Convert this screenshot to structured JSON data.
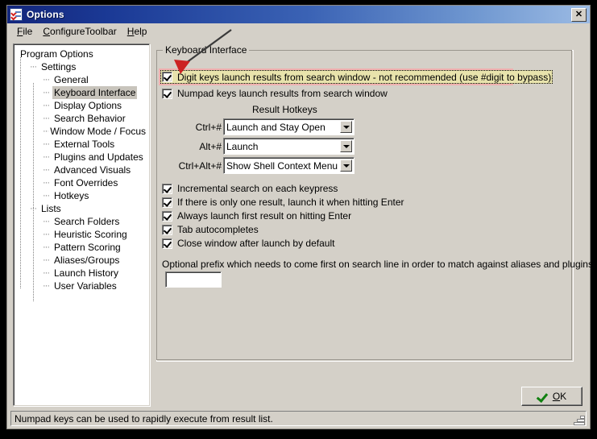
{
  "window": {
    "title": "Options",
    "icon": "options-checklist-icon",
    "close_label": "✕"
  },
  "menubar": {
    "items": [
      {
        "label": "File",
        "accel": "F"
      },
      {
        "label": "ConfigureToolbar",
        "accel": "C"
      },
      {
        "label": "Help",
        "accel": "H"
      }
    ]
  },
  "tree": {
    "nodes": [
      {
        "label": "Program Options",
        "level": 0,
        "selected": false
      },
      {
        "label": "Settings",
        "level": 1,
        "selected": false
      },
      {
        "label": "General",
        "level": 2,
        "selected": false
      },
      {
        "label": "Keyboard Interface",
        "level": 2,
        "selected": true
      },
      {
        "label": "Display Options",
        "level": 2,
        "selected": false
      },
      {
        "label": "Search Behavior",
        "level": 2,
        "selected": false
      },
      {
        "label": "Window Mode / Focus",
        "level": 2,
        "selected": false
      },
      {
        "label": "External Tools",
        "level": 2,
        "selected": false
      },
      {
        "label": "Plugins and Updates",
        "level": 2,
        "selected": false
      },
      {
        "label": "Advanced Visuals",
        "level": 2,
        "selected": false
      },
      {
        "label": "Font Overrides",
        "level": 2,
        "selected": false
      },
      {
        "label": "Hotkeys",
        "level": 2,
        "selected": false
      },
      {
        "label": "Lists",
        "level": 1,
        "selected": false
      },
      {
        "label": "Search Folders",
        "level": 2,
        "selected": false
      },
      {
        "label": "Heuristic Scoring",
        "level": 2,
        "selected": false
      },
      {
        "label": "Pattern Scoring",
        "level": 2,
        "selected": false
      },
      {
        "label": "Aliases/Groups",
        "level": 2,
        "selected": false
      },
      {
        "label": "Launch History",
        "level": 2,
        "selected": false
      },
      {
        "label": "User Variables",
        "level": 2,
        "selected": false
      }
    ]
  },
  "groupbox": {
    "title": "Keyboard Interface",
    "top_checkboxes": [
      {
        "label": "Digit keys launch results from search window  - not recommended (use #digit to bypass)",
        "checked": true,
        "highlighted": true
      },
      {
        "label": "Numpad keys launch results from search window",
        "checked": true,
        "highlighted": false
      }
    ],
    "result_hotkeys": {
      "title": "Result Hotkeys",
      "rows": [
        {
          "label": "Ctrl+#",
          "value": "Launch and Stay Open"
        },
        {
          "label": "Alt+#",
          "value": "Launch"
        },
        {
          "label": "Ctrl+Alt+#",
          "value": "Show Shell Context Menu"
        }
      ]
    },
    "options": [
      {
        "label": "Incremental search on each keypress",
        "checked": true
      },
      {
        "label": "If there is only one result, launch it when hitting Enter",
        "checked": true
      },
      {
        "label": "Always launch first result on hitting Enter",
        "checked": true
      },
      {
        "label": "Tab autocompletes",
        "checked": true
      },
      {
        "label": "Close window after launch by default",
        "checked": true
      }
    ],
    "prefix": {
      "label": "Optional prefix which needs to come first on search line in order to match against aliases and plugins:",
      "value": "",
      "placeholder": ""
    }
  },
  "ok_button": {
    "label": "OK",
    "accel": "O",
    "icon": "green-check-icon"
  },
  "statusbar": {
    "text": "Numpad keys can be used to rapidly execute from result list."
  },
  "annotation": {
    "type": "arrow",
    "color": "#cc2222",
    "line_color": "#3a3a3a"
  },
  "colors": {
    "window_face": "#d4d0c8",
    "title_gradient_start": "#13267c",
    "title_gradient_end": "#9cbbe4",
    "highlight_bg": "#e8e3ac",
    "highlight_border": "#f0b0b0",
    "tree_selected_bg": "#c8c4bc",
    "ok_check": "#108010"
  }
}
